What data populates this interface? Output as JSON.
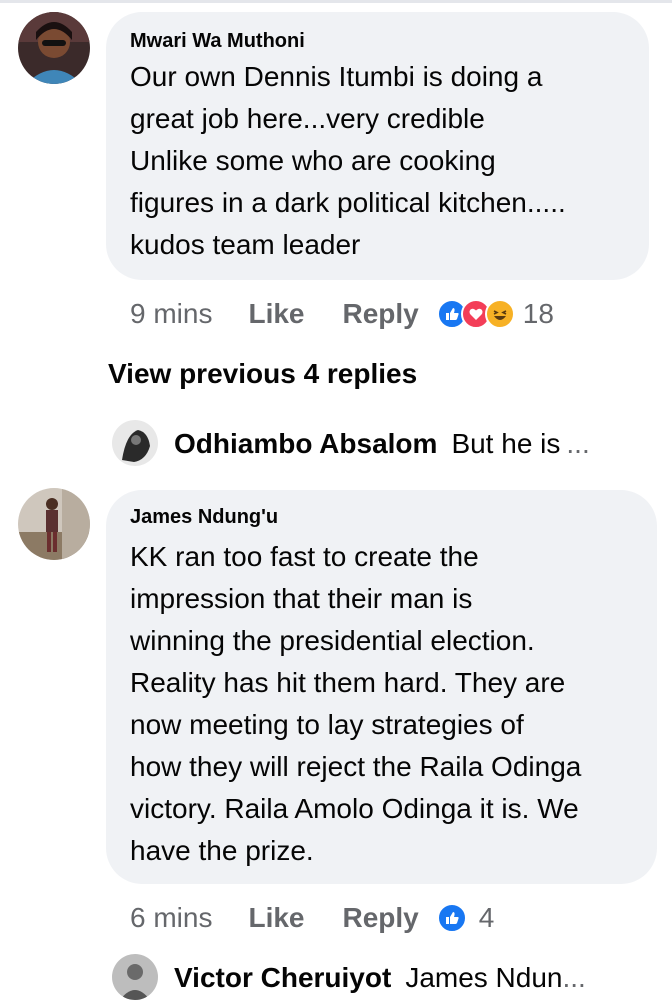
{
  "comments": [
    {
      "author": "Mwari Wa Muthoni",
      "text": "Our own Dennis Itumbi is doing a\ngreat job here...very credible\nUnlike some who are cooking\nfigures in a dark political kitchen.....\nkudos team leader",
      "time": "9 mins",
      "like_label": "Like",
      "reply_label": "Reply",
      "reactions": [
        "like-icon",
        "love-icon",
        "haha-icon"
      ],
      "reaction_count": "18"
    },
    {
      "author": "James Ndung'u",
      "text": "KK ran too fast to create the\nimpression that their man is\nwinning the presidential election.\nReality has hit them hard. They are\nnow meeting to lay strategies of\nhow they will reject the Raila Odinga\nvictory. Raila Amolo Odinga it is. We\nhave the prize.",
      "time": "6 mins",
      "like_label": "Like",
      "reply_label": "Reply",
      "reactions": [
        "like-icon"
      ],
      "reaction_count": "4"
    }
  ],
  "view_previous_label": "View previous 4 replies",
  "replies": [
    {
      "author": "Odhiambo Absalom",
      "preview": "But he is",
      "ellipsis": "..."
    },
    {
      "author": "Victor Cheruiyot",
      "preview": "James Ndun",
      "ellipsis": "..."
    }
  ],
  "colors": {
    "bubble": "#f0f2f5",
    "like_blue": "#1877f2",
    "love_red": "#f33e58",
    "haha_yellow": "#f7b125",
    "meta_gray": "#65676b"
  }
}
